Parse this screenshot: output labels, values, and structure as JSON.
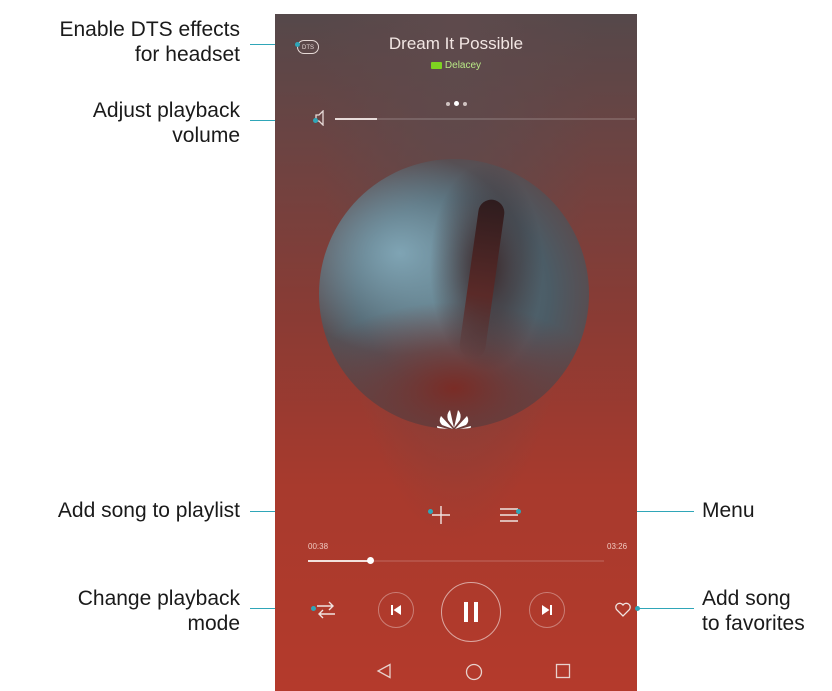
{
  "annotations": {
    "dts": [
      "Enable DTS effects",
      "for headset"
    ],
    "volume": [
      "Adjust playback",
      "volume"
    ],
    "add_playlist": [
      "Add song to playlist"
    ],
    "play_mode": [
      "Change playback",
      "mode"
    ],
    "menu": [
      "Menu"
    ],
    "favorites": [
      "Add song",
      "to favorites"
    ]
  },
  "player": {
    "song_title": "Dream It Possible",
    "album_label": "Delacey",
    "page_indicator": {
      "count": 3,
      "active_index": 1
    },
    "volume_level": 0.14,
    "elapsed_time": "00:38",
    "total_time": "03:26",
    "progress": 0.21,
    "state": "playing",
    "logo_text": "HUAWEI"
  },
  "icons": {
    "dts": "dts-icon",
    "volume": "speaker-icon",
    "add": "plus-icon",
    "menu": "menu-icon",
    "play_mode": "shuffle-icon",
    "previous": "skip-previous-icon",
    "play_pause": "pause-icon",
    "next": "skip-next-icon",
    "favorite": "heart-icon",
    "nav_back": "triangle-back-icon",
    "nav_home": "circle-home-icon",
    "nav_recent": "square-recents-icon"
  },
  "colors": {
    "leader_line": "#2fa6b8",
    "background_top": "#55484a",
    "background_bottom": "#b43a2c",
    "album_tag": "#7ed321"
  }
}
